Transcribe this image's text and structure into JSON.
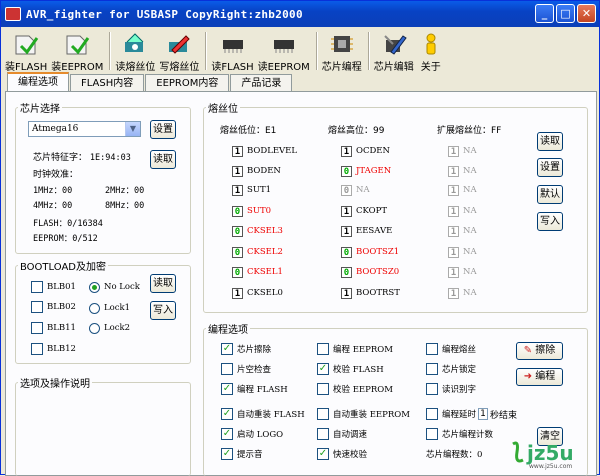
{
  "window": {
    "title": "AVR_fighter for USBASP CopyRight:zhb2000",
    "btn_min": "_",
    "btn_max": "□",
    "btn_close": "✕"
  },
  "toolbar": [
    {
      "label": "装FLASH",
      "icon": "load-flash-icon"
    },
    {
      "label": "装EEPROM",
      "icon": "load-eeprom-icon"
    },
    {
      "label": "读熔丝位",
      "icon": "read-fuse-icon"
    },
    {
      "label": "写熔丝位",
      "icon": "write-fuse-icon"
    },
    {
      "label": "读FLASH",
      "icon": "read-flash-icon"
    },
    {
      "label": "读EEPROM",
      "icon": "read-eeprom-icon"
    },
    {
      "label": "芯片编程",
      "icon": "chip-program-icon"
    },
    {
      "label": "芯片编辑",
      "icon": "chip-edit-icon"
    },
    {
      "label": "关于",
      "icon": "about-icon"
    }
  ],
  "tabs": [
    "编程选项",
    "FLASH内容",
    "EEPROM内容",
    "产品记录"
  ],
  "chip": {
    "legend": "芯片选择",
    "selected": "Atmega16",
    "set_btn": "设置",
    "read_btn": "读取",
    "signature_label": "芯片特征字：",
    "signature": "1E:94:03",
    "clock_label": "时钟效准：",
    "clocks": [
      "1MHz：00",
      "2MHz：00",
      "4MHz：00",
      "8MHz：00"
    ],
    "flash": "FLASH：0/16384",
    "eeprom": "EEPROM：0/512"
  },
  "bootload": {
    "legend": "BOOTLOAD及加密",
    "checks": [
      "BLB01",
      "BLB02",
      "BLB11",
      "BLB12"
    ],
    "radios": [
      "No Lock",
      "Lock1",
      "Lock2"
    ],
    "read_btn": "读取",
    "write_btn": "写入"
  },
  "desc": {
    "legend": "选项及操作说明"
  },
  "fuse": {
    "legend": "熔丝位",
    "low_label": "熔丝低位：E1",
    "high_label": "熔丝高位：99",
    "ext_label": "扩展熔丝位：FF",
    "low": [
      {
        "v": "1",
        "name": "BODLEVEL",
        "c": ""
      },
      {
        "v": "1",
        "name": "BODEN",
        "c": ""
      },
      {
        "v": "1",
        "name": "SUT1",
        "c": ""
      },
      {
        "v": "0",
        "name": "SUT0",
        "c": "red"
      },
      {
        "v": "0",
        "name": "CKSEL3",
        "c": "red"
      },
      {
        "v": "0",
        "name": "CKSEL2",
        "c": "red"
      },
      {
        "v": "0",
        "name": "CKSEL1",
        "c": "red"
      },
      {
        "v": "1",
        "name": "CKSEL0",
        "c": ""
      }
    ],
    "high": [
      {
        "v": "1",
        "name": "OCDEN",
        "c": ""
      },
      {
        "v": "0",
        "name": "JTAGEN",
        "c": "red"
      },
      {
        "v": "0",
        "name": "NA",
        "c": "gray"
      },
      {
        "v": "1",
        "name": "CKOPT",
        "c": ""
      },
      {
        "v": "1",
        "name": "EESAVE",
        "c": ""
      },
      {
        "v": "0",
        "name": "BOOTSZ1",
        "c": "red"
      },
      {
        "v": "0",
        "name": "BOOTSZ0",
        "c": "red"
      },
      {
        "v": "1",
        "name": "BOOTRST",
        "c": ""
      }
    ],
    "ext": [
      {
        "v": "1",
        "name": "NA"
      },
      {
        "v": "1",
        "name": "NA"
      },
      {
        "v": "1",
        "name": "NA"
      },
      {
        "v": "1",
        "name": "NA"
      },
      {
        "v": "1",
        "name": "NA"
      },
      {
        "v": "1",
        "name": "NA"
      },
      {
        "v": "1",
        "name": "NA"
      },
      {
        "v": "1",
        "name": "NA"
      }
    ],
    "btns": [
      "读取",
      "设置",
      "默认",
      "写入"
    ]
  },
  "prog": {
    "legend": "编程选项",
    "rows": [
      [
        {
          "t": "芯片擦除",
          "on": true
        },
        {
          "t": "编程 EEPROM",
          "on": false
        },
        {
          "t": "编程熔丝",
          "on": false
        }
      ],
      [
        {
          "t": "片空检查",
          "on": false
        },
        {
          "t": "校验 FLASH",
          "on": true
        },
        {
          "t": "芯片锁定",
          "on": false
        }
      ],
      [
        {
          "t": "编程 FLASH",
          "on": true
        },
        {
          "t": "校验 EEPROM",
          "on": false
        },
        {
          "t": "读识别字",
          "on": false
        }
      ],
      [
        {
          "t": "自动重装 FLASH",
          "on": true
        },
        {
          "t": "自动重装 EEPROM",
          "on": false
        },
        {
          "t": "编程延时",
          "on": false
        }
      ],
      [
        {
          "t": "启动 LOGO",
          "on": true
        },
        {
          "t": "自动调速",
          "on": false
        },
        {
          "t": "芯片编程计数",
          "on": false
        }
      ],
      [
        {
          "t": "提示音",
          "on": true
        },
        {
          "t": "快速校验",
          "on": true
        },
        {
          "t": "芯片编程数：0",
          "on": null
        }
      ]
    ],
    "delay_value": "1",
    "delay_suffix": "秒结束",
    "erase_btn": "擦除",
    "program_btn": "编程",
    "clear_btn": "清空"
  },
  "logo": {
    "text": "jz5u",
    "sub": "www.jz5u.com"
  }
}
